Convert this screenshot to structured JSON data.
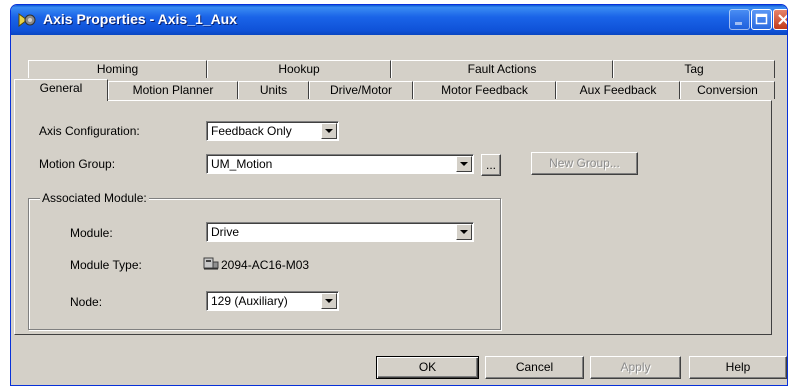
{
  "window": {
    "title": "Axis Properties - Axis_1_Aux"
  },
  "tabs": {
    "row_back": [
      "Homing",
      "Hookup",
      "Fault Actions",
      "Tag"
    ],
    "row_front": [
      "General",
      "Motion Planner",
      "Units",
      "Drive/Motor",
      "Motor Feedback",
      "Aux Feedback",
      "Conversion"
    ],
    "active": "General"
  },
  "general": {
    "axis_configuration_label": "Axis Configuration:",
    "axis_configuration_value": "Feedback Only",
    "motion_group_label": "Motion Group:",
    "motion_group_value": "UM_Motion",
    "browse_label": "...",
    "new_group_label": "New Group...",
    "associated_module_legend": "Associated Module:",
    "module_label": "Module:",
    "module_value": "Drive",
    "module_type_label": "Module Type:",
    "module_type_value": "2094-AC16-M03",
    "node_label": "Node:",
    "node_value": "129 (Auxiliary)"
  },
  "buttons": {
    "ok": "OK",
    "cancel": "Cancel",
    "apply": "Apply",
    "help": "Help"
  }
}
